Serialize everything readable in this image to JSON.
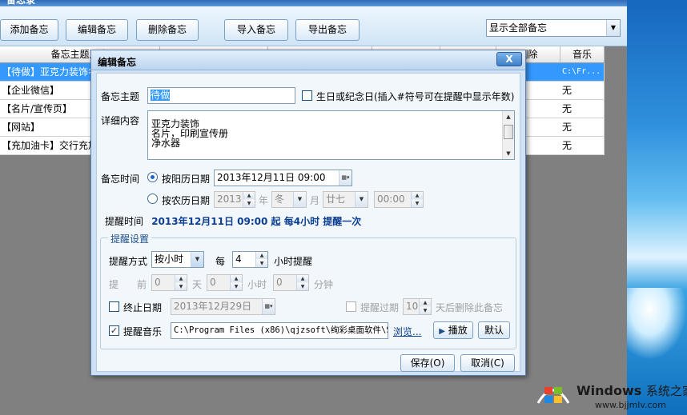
{
  "main_window": {
    "title": "备忘录",
    "toolbar": {
      "add_label": "添加备忘",
      "edit_label": "编辑备忘",
      "delete_label": "删除备忘",
      "import_label": "导入备忘",
      "export_label": "导出备忘"
    },
    "filter": {
      "value": "显示全部备忘"
    },
    "grid": {
      "headers": [
        "备忘主题及内",
        "",
        "",
        "",
        "",
        "删除",
        "音乐"
      ],
      "rows": [
        {
          "subject": "【待做】亚克力装饰名",
          "music": "C:\\Fr..."
        },
        {
          "subject": "【企业微信】",
          "music": "无"
        },
        {
          "subject": "【名片/宣传页】",
          "music": "无"
        },
        {
          "subject": "【网站】",
          "music": "无"
        },
        {
          "subject": "【充加油卡】交行充加",
          "music": "无"
        }
      ]
    }
  },
  "dialog": {
    "title": "编辑备忘",
    "close_label": "X",
    "subject_label": "备忘主题",
    "subject_value": "待做",
    "birthday_label": "生日或纪念日(插入#符号可在提醒中显示年数)",
    "detail_label": "详细内容",
    "detail_lines": [
      "亚克力装饰",
      "名片，印刷宣传册",
      "净水器"
    ],
    "time_label": "备忘时间",
    "solar_label": "按阳历日期",
    "solar_value": "2013年12月11日  09:00",
    "lunar_label": "按农历日期",
    "lunar_year": "2013",
    "lunar_year_unit": "年",
    "lunar_month": "冬",
    "lunar_month_unit": "月",
    "lunar_day": "廿七",
    "lunar_time": "00:00",
    "remind_time_label": "提醒时间",
    "remind_time_value": "2013年12月11日  09:00  起  每4小时  提醒一次",
    "group_title": "提醒设置",
    "mode_label": "提醒方式",
    "mode_value": "按小时",
    "every_label": "每",
    "every_value": "4",
    "every_suffix": "小时提醒",
    "advance_label_1": "提",
    "advance_label_2": "前",
    "advance_days": "0",
    "advance_days_unit": "天",
    "advance_hours": "0",
    "advance_hours_unit": "小时",
    "advance_minutes": "0",
    "advance_minutes_unit": "分钟",
    "end_date_label": "终止日期",
    "end_date_value": "2013年12月29日",
    "expire_label": "提醒过期",
    "expire_value": "10",
    "expire_suffix": "天后删除此备忘",
    "music_label": "提醒音乐",
    "music_path": "C:\\Program Files (x86)\\qjzsoft\\绚彩桌面软件\\S",
    "browse_label": "浏览...",
    "play_label": "播放",
    "default_label": "默认",
    "save_label": "保存(O)",
    "cancel_label": "取消(C)"
  },
  "watermark": {
    "brand": "Windows",
    "brand_zh": "系统之家",
    "url": "www.bjjmlv.com"
  }
}
